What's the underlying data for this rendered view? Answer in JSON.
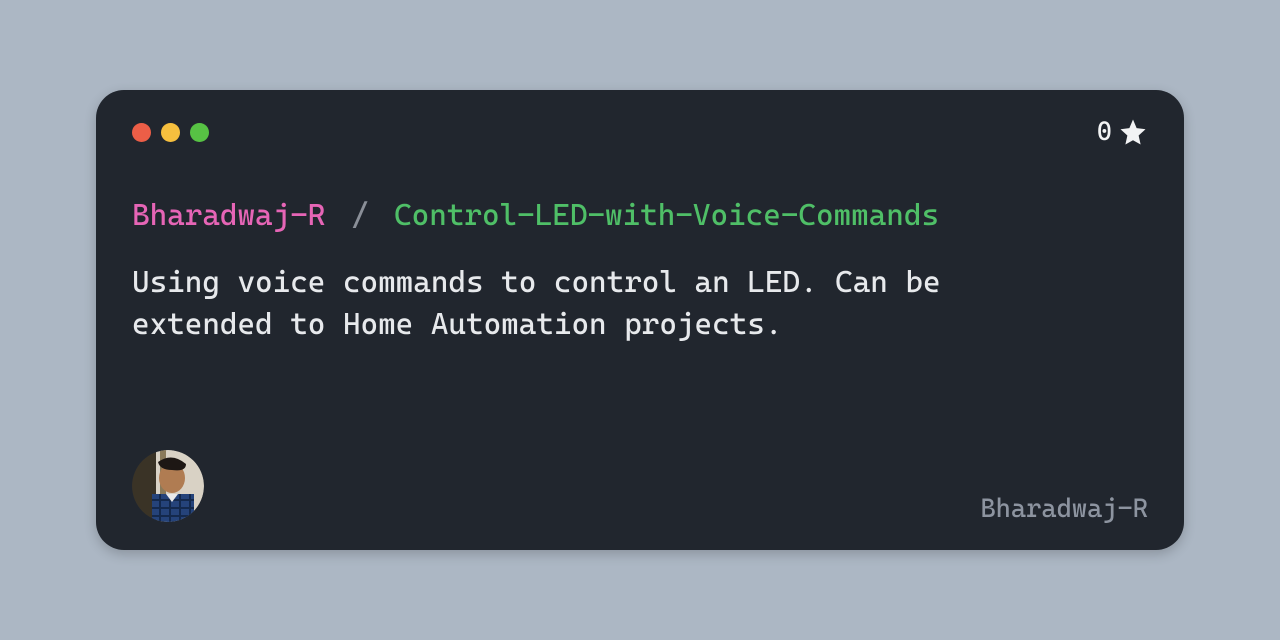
{
  "stars": "0",
  "owner": "Bharadwaj-R",
  "separator": "/",
  "repo": "Control-LED-with-Voice-Commands",
  "description": "Using voice commands to control an LED. Can be extended to Home Automation projects.",
  "footer_name": "Bharadwaj-R"
}
